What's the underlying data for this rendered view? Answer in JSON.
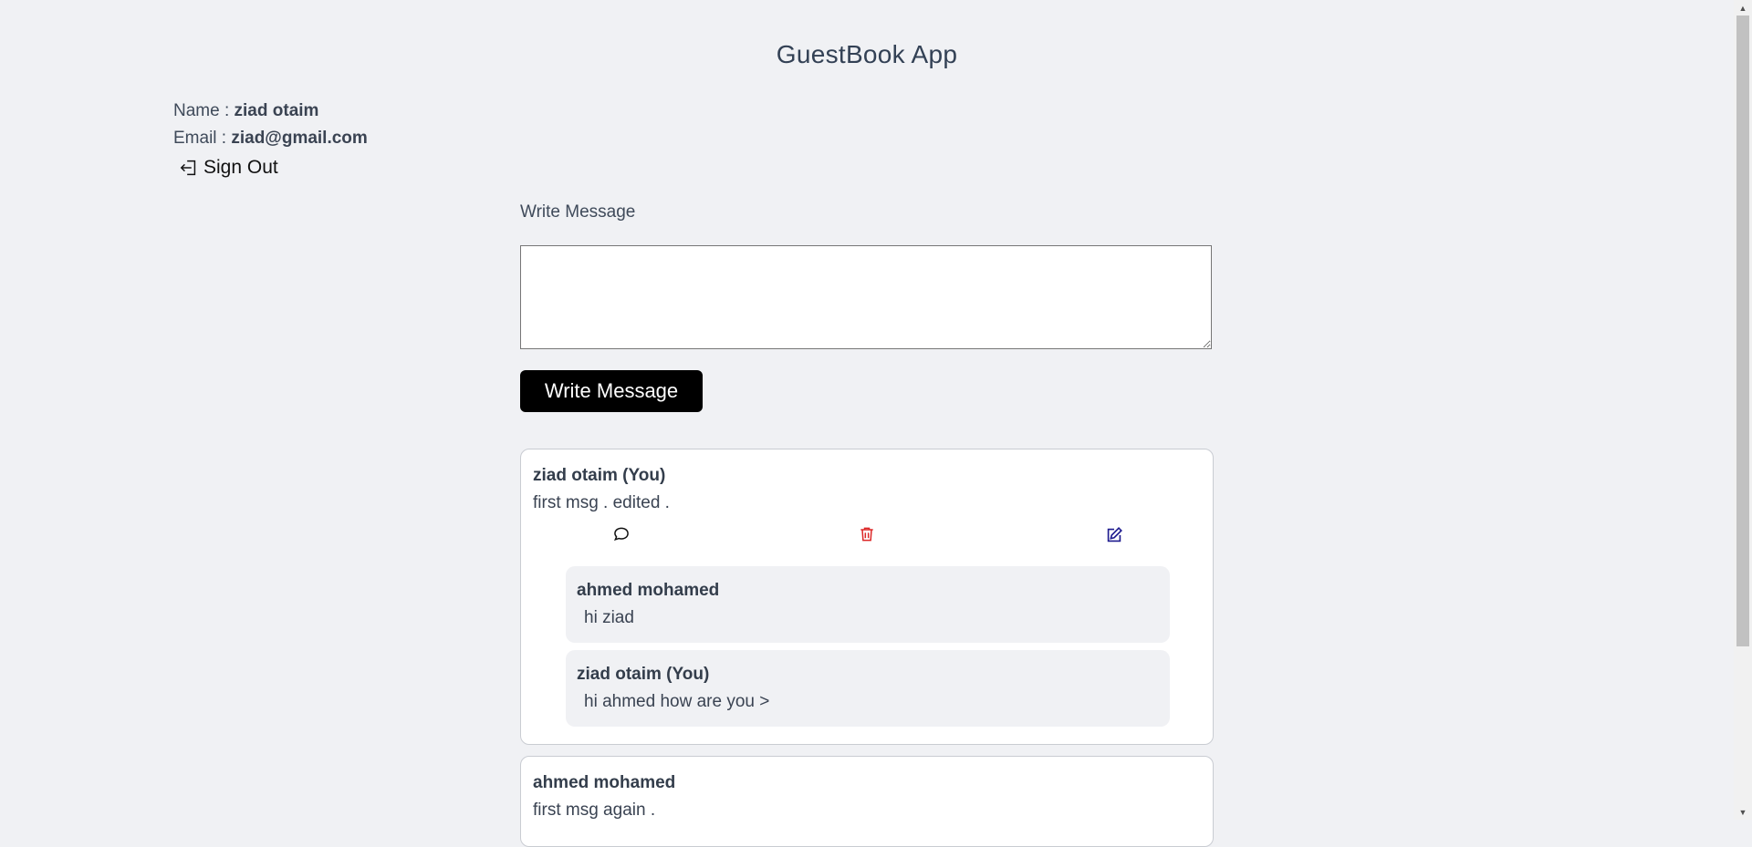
{
  "app": {
    "title": "GuestBook App"
  },
  "user": {
    "name_label": "Name :",
    "name_value": "ziad otaim",
    "email_label": "Email :",
    "email_value": "ziad@gmail.com",
    "signout_label": "Sign Out"
  },
  "composer": {
    "label": "Write Message",
    "input_value": "",
    "button_label": "Write Message"
  },
  "messages": [
    {
      "author": "ziad otaim (You)",
      "text": "first msg . edited .",
      "actions": {
        "reply_icon": "comment-icon",
        "delete_icon": "trash-icon",
        "edit_icon": "edit-icon"
      },
      "replies": [
        {
          "author": "ahmed mohamed",
          "text": "hi ziad"
        },
        {
          "author": "ziad otaim (You)",
          "text": "hi ahmed how are you >"
        }
      ]
    },
    {
      "author": "ahmed mohamed",
      "text": "first msg again ."
    }
  ],
  "colors": {
    "delete": "#dc2626",
    "edit": "#1e1b8f",
    "button_bg": "#000000",
    "page_bg": "#f0f1f4"
  }
}
